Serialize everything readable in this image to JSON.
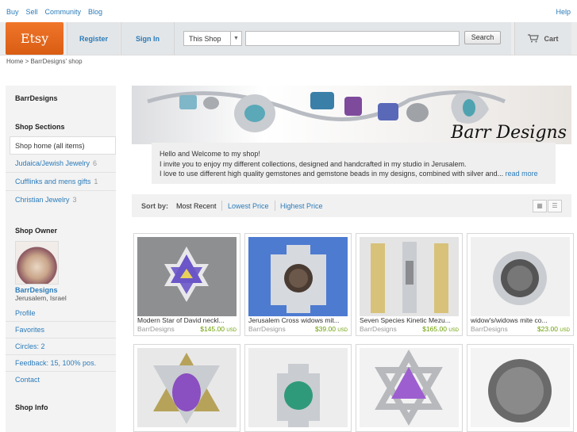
{
  "topnav": {
    "buy": "Buy",
    "sell": "Sell",
    "community": "Community",
    "blog": "Blog",
    "help": "Help"
  },
  "header": {
    "logo": "Etsy",
    "register": "Register",
    "signin": "Sign In",
    "scope": "This Shop",
    "search_button": "Search",
    "cart": "Cart"
  },
  "breadcrumb": "Home > BarrDesigns' shop",
  "sidebar": {
    "shop_name": "BarrDesigns",
    "sections_title": "Shop Sections",
    "sections": [
      {
        "label": "Shop home (all items)",
        "count": ""
      },
      {
        "label": "Judaica/Jewish Jewelry",
        "count": "6"
      },
      {
        "label": "Cufflinks and mens gifts",
        "count": "1"
      },
      {
        "label": "Christian Jewelry",
        "count": "3"
      }
    ],
    "owner_title": "Shop Owner",
    "owner_name": "BarrDesigns",
    "owner_location": "Jerusalem, Israel",
    "links": [
      "Profile",
      "Favorites",
      "Circles: 2",
      "Feedback: 15, 100% pos.",
      "Contact"
    ],
    "info_title": "Shop Info"
  },
  "banner": {
    "title": "Barr Designs"
  },
  "welcome": {
    "line1": "Hello and Welcome to my shop!",
    "line2": "I invite you to enjoy my different collections, designed and handcrafted in my studio in Jerusalem.",
    "line3": "I love to use different high quality gemstones and gemstone beads in my designs, combined with silver and...",
    "read_more": "read more"
  },
  "sort": {
    "label": "Sort by:",
    "options": [
      "Most Recent",
      "Lowest Price",
      "Highest Price"
    ]
  },
  "items": [
    {
      "title": "Modern Star of David neckl...",
      "shop": "BarrDesigns",
      "price": "$145.00",
      "currency": "USD"
    },
    {
      "title": "Jerusalem Cross widows mit...",
      "shop": "BarrDesigns",
      "price": "$39.00",
      "currency": "USD"
    },
    {
      "title": "Seven Species Kinetic Mezu...",
      "shop": "BarrDesigns",
      "price": "$165.00",
      "currency": "USD"
    },
    {
      "title": "widow's/widows mite co...",
      "shop": "BarrDesigns",
      "price": "$23.00",
      "currency": "USD"
    },
    {
      "title": "",
      "shop": "",
      "price": "",
      "currency": ""
    },
    {
      "title": "",
      "shop": "",
      "price": "",
      "currency": ""
    },
    {
      "title": "",
      "shop": "",
      "price": "",
      "currency": ""
    },
    {
      "title": "",
      "shop": "",
      "price": "",
      "currency": ""
    }
  ]
}
